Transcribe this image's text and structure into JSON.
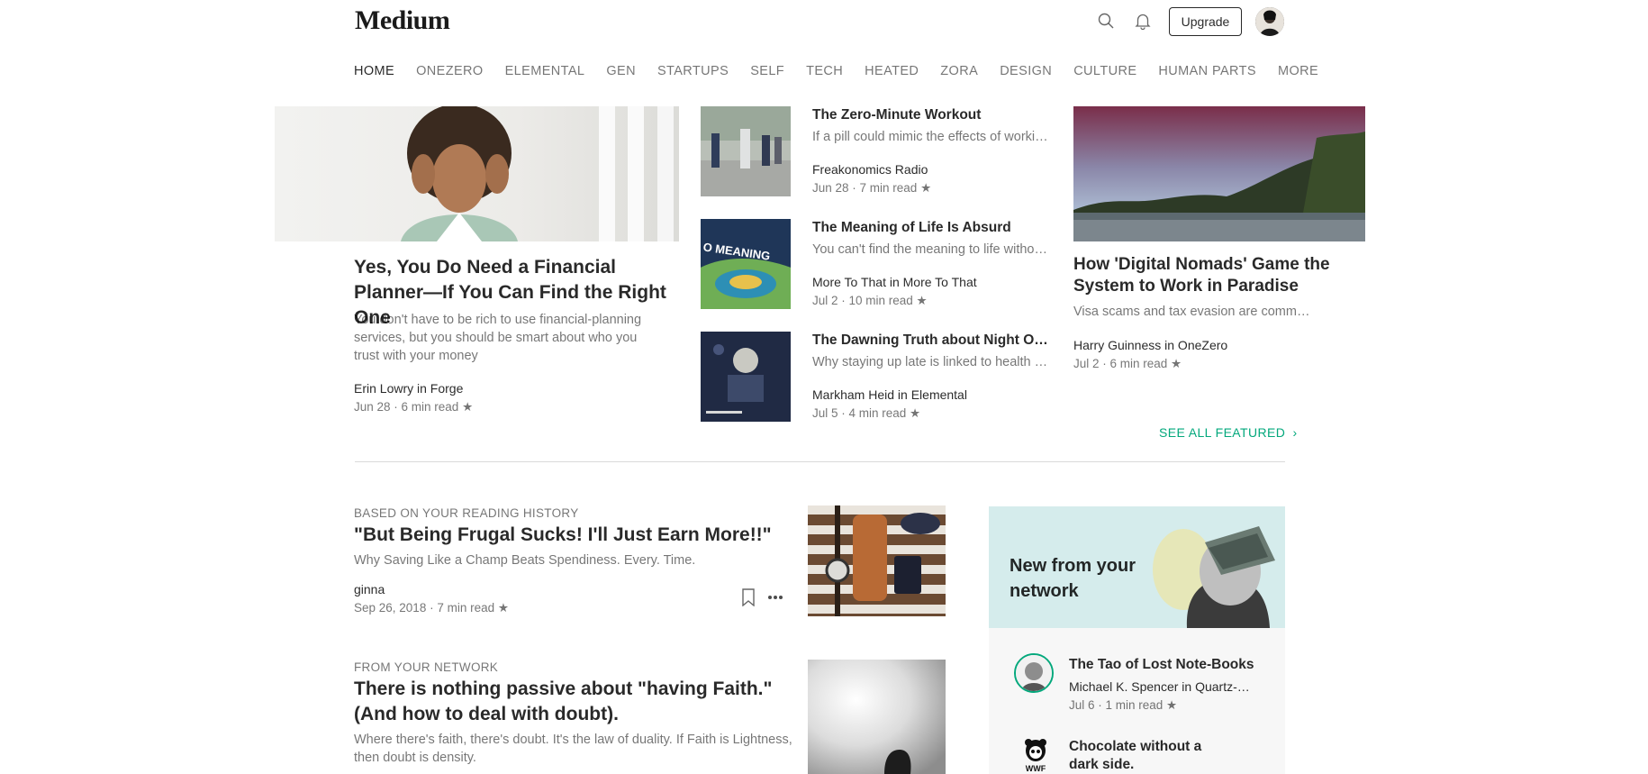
{
  "header": {
    "logo": "Medium",
    "upgrade_label": "Upgrade",
    "icons": [
      "search-icon",
      "bell-icon"
    ]
  },
  "nav": {
    "items": [
      "HOME",
      "ONEZERO",
      "ELEMENTAL",
      "GEN",
      "STARTUPS",
      "SELF",
      "TECH",
      "HEATED",
      "ZORA",
      "DESIGN",
      "CULTURE",
      "HUMAN PARTS",
      "MORE"
    ]
  },
  "featured": {
    "main": {
      "title": "Yes, You Do Need a Financial Planner—If You Can Find the Right One",
      "subtitle": "You don't have to be rich to use financial-planning services, but you should be smart about who you trust with your money",
      "author": "Erin Lowry in Forge",
      "date": "Jun 28 · 6 min read ★"
    },
    "middle": [
      {
        "title": "The Zero-Minute Workout",
        "subtitle": "If a pill could mimic the effects of working out…",
        "author": "Freakonomics Radio",
        "date": "Jun 28 · 7 min read ★"
      },
      {
        "title": "The Meaning of Life Is Absurd",
        "subtitle": "You can't find the meaning to life without…",
        "author": "More To That in More To That",
        "date": "Jul 2 · 10 min read ★"
      },
      {
        "title": "The Dawning Truth about Night Owls",
        "subtitle": "Why staying up late is linked to health p…",
        "author": "Markham Heid in Elemental",
        "date": "Jul 5 · 4 min read ★"
      }
    ],
    "right": {
      "title": "How 'Digital Nomads' Game the System to Work in Paradise",
      "subtitle": "Visa scams and tax evasion are commo…",
      "author": "Harry Guinness in OneZero",
      "date": "Jul 2 · 6 min read ★"
    },
    "meaning_image_text": "O MEANING",
    "see_all": "SEE ALL FEATURED",
    "see_all_chevron": "›"
  },
  "feed": [
    {
      "kicker": "BASED ON YOUR READING HISTORY",
      "title": "\"But Being Frugal Sucks! I'll Just Earn More!!\"",
      "subtitle": "Why Saving Like a Champ Beats Spendiness. Every. Time.",
      "author": "ginna",
      "date": "Sep 26, 2018 · 7 min read ★"
    },
    {
      "kicker": "FROM YOUR NETWORK",
      "title": "There is nothing passive about \"having Faith.\" (And how to deal with doubt).",
      "subtitle": "Where there's faith, there's doubt. It's the law of duality. If Faith is Lightness, then doubt is density."
    }
  ],
  "network": {
    "heading": "New from your network",
    "items": [
      {
        "title": "The Tao of Lost Note-Books",
        "author": "Michael K. Spencer in Quartz-Bo…",
        "date": "Jul 6 · 1 min read ★"
      },
      {
        "title": "Chocolate without a dark side.",
        "logo_text": "WWF"
      }
    ]
  },
  "colors": {
    "accent_green": "#03a87c",
    "network_banner": "#d5ecec"
  }
}
